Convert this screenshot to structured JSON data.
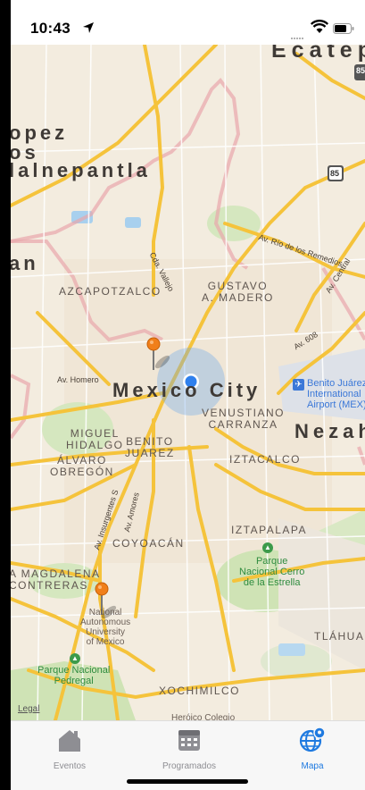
{
  "status_bar": {
    "time": "10:43"
  },
  "map": {
    "labels": {
      "ecatepec": "Ecatepe",
      "lopez": "opez",
      "os": "os",
      "tlalnepantla": "lalnepantla",
      "an": "an",
      "azcapotzalco": "AZCAPOTZALCO",
      "gustavo": "GUSTAVO\nA. MADERO",
      "mexico_city": "Mexico City",
      "venustiano": "VENUSTIANO\nCARRANZA",
      "nezah": "Nezah",
      "miguel": "MIGUEL\nHIDALGO",
      "benito": "BENITO\nJUAREZ",
      "alvaro": "ÁLVARO\nOBREGÓN",
      "iztacalco": "IZTACALCO",
      "coyoacan": "COYOACÁN",
      "iztapalapa": "IZTAPALAPA",
      "magdalena": "A MAGDALENA\nCONTRERAS",
      "xochimilco": "XOCHIMILCO",
      "tlahuac": "TLÁHUAC",
      "airport": "Benito Juárez\nInternational\nAirport (MEX)",
      "cerro_estrella": "Parque\nNacional Cerro\nde la Estrella",
      "pedregal": "Parque Nacional\nPedregal",
      "unam": "National\nAutonomous\nUniversity\nof Mexico",
      "heroico": "Heróico Colegio",
      "rio_remedios": "Av. Río de los Remedios",
      "av_central": "Av. Central",
      "av_608": "Av. 608",
      "cda_vallejo": "Cda. Vallejo",
      "av_homero": "Av. Homero",
      "av_insurgentes": "Av. Insurgentes S",
      "av_amores": "Av. Amores",
      "hw_85_a": "85",
      "hw_85_b": "85"
    },
    "legal": "Legal"
  },
  "tabs": [
    {
      "label": "Eventos",
      "icon": "house-icon",
      "active": false
    },
    {
      "label": "Programados",
      "icon": "calendar-grid-icon",
      "active": false
    },
    {
      "label": "Mapa",
      "icon": "globe-pin-icon",
      "active": true
    }
  ],
  "colors": {
    "accent": "#1f7ae0",
    "inactive": "#8e8e93",
    "pin": "#f07f1a",
    "road": "#f5c33b",
    "boundary": "#e79aa0"
  }
}
